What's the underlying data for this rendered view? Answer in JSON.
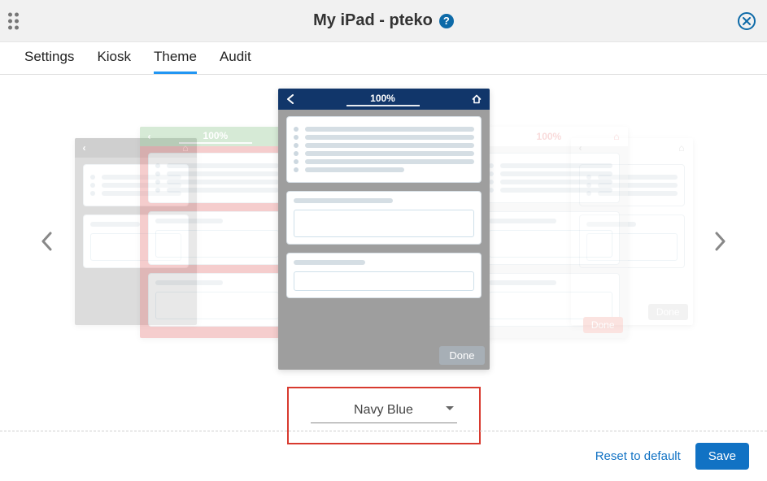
{
  "header": {
    "title": "My iPad - pteko",
    "help_tooltip": "?"
  },
  "tabs": {
    "items": [
      {
        "label": "Settings",
        "active": false
      },
      {
        "label": "Kiosk",
        "active": false
      },
      {
        "label": "Theme",
        "active": true
      },
      {
        "label": "Audit",
        "active": false
      }
    ]
  },
  "carousel": {
    "progress_label": "100%",
    "done_label": "Done",
    "side_progress": "100%"
  },
  "theme_select": {
    "selected": "Navy Blue"
  },
  "footer": {
    "reset_label": "Reset to default",
    "save_label": "Save"
  }
}
